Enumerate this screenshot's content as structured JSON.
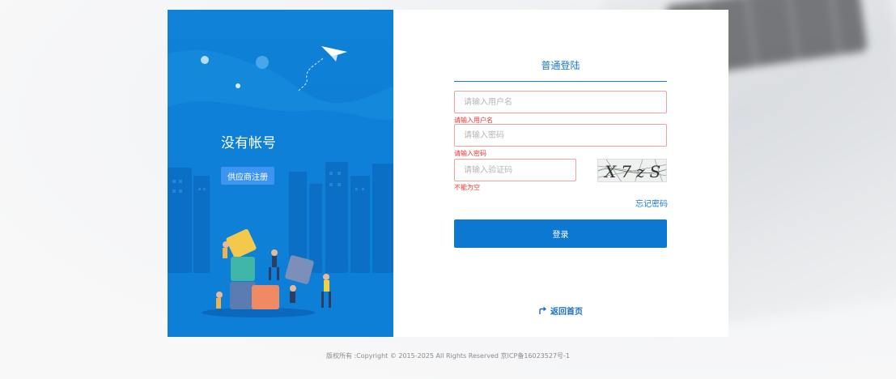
{
  "left_panel": {
    "heading": "没有帐号",
    "register_button": "供应商注册"
  },
  "login": {
    "tab_title": "普通登陆",
    "username": {
      "placeholder": "请输入用户名",
      "error": "请输入用户名"
    },
    "password": {
      "placeholder": "请输入密码",
      "error": "请输入密码"
    },
    "captcha": {
      "placeholder": "请输入验证码",
      "error": "不能为空",
      "image_text": "X7zS"
    },
    "forgot_password": "忘记密码",
    "submit": "登录",
    "back_home": "返回首页"
  },
  "footer": {
    "copyright": "版权所有 :Copyright © 2015-2025 All Rights Reserved 京ICP备16023527号-1"
  },
  "icons": {
    "paper_plane": "paper-plane-icon",
    "back_home": "share-arrow-icon"
  },
  "colors": {
    "brand_blue": "#0c78d2",
    "error_red": "#e33333",
    "register_blue": "#3e95f0"
  }
}
